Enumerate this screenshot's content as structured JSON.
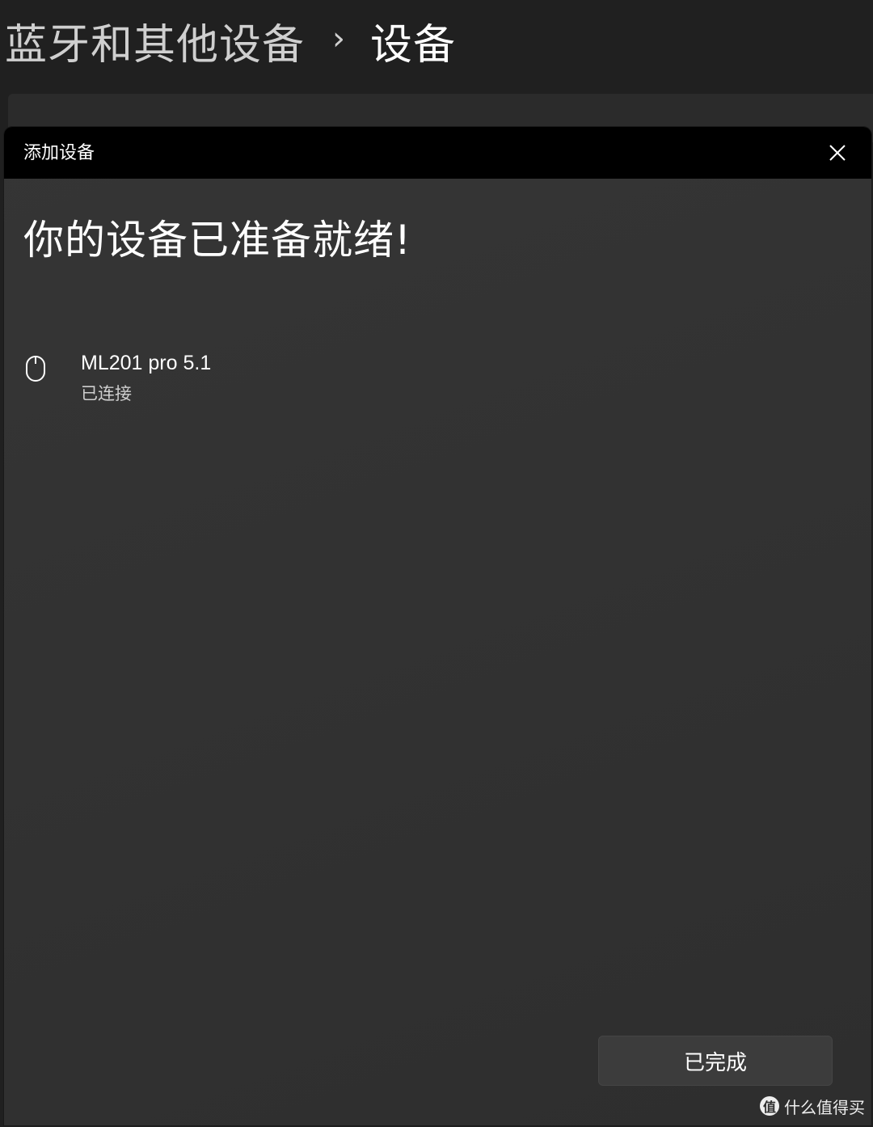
{
  "header": {
    "breadcrumb_parent": "蓝牙和其他设备",
    "breadcrumb_separator": "›",
    "breadcrumb_current": "设备"
  },
  "dialog": {
    "title": "添加设备",
    "heading": "你的设备已准备就绪!",
    "close_icon": "close-icon",
    "device": {
      "icon": "mouse-icon",
      "name": "ML201 pro 5.1",
      "status": "已连接"
    },
    "done_label": "已完成"
  },
  "watermark": {
    "logo_glyph": "值",
    "text": "什么值得买"
  },
  "colors": {
    "background": "#202020",
    "titlebar": "#000000",
    "dialog": "#323232",
    "button": "#3c3c3c",
    "text": "#ffffff",
    "secondary_text": "#cfcfcf"
  }
}
